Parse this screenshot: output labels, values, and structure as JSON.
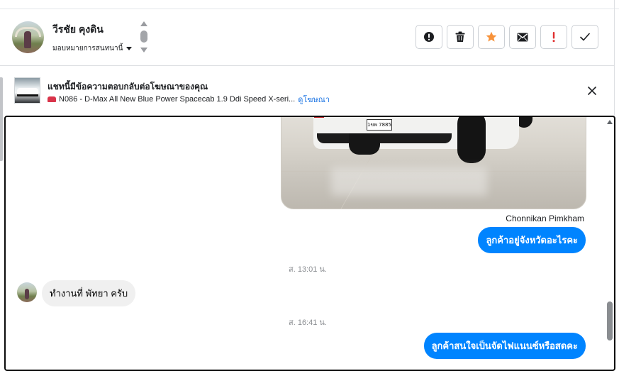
{
  "header": {
    "contact_name": "วีรชัย คุงดิน",
    "assign_label": "มอบหมายการสนทนานี้",
    "actions": [
      {
        "name": "report-button",
        "icon": "exclamation-circle-icon"
      },
      {
        "name": "delete-button",
        "icon": "trash-icon"
      },
      {
        "name": "star-button",
        "icon": "star-icon",
        "color": "#f7923a"
      },
      {
        "name": "mark-unread-button",
        "icon": "envelope-icon"
      },
      {
        "name": "important-button",
        "icon": "exclamation-icon",
        "color": "#e02e2e"
      },
      {
        "name": "mark-done-button",
        "icon": "check-icon"
      }
    ]
  },
  "ad_banner": {
    "title": "แชทนี้มีข้อความตอบกลับต่อโฆษณาของคุณ",
    "ad_text": "N086 - D-Max All New Blue Power Spacecab 1.9 Ddi Speed X-seri...",
    "view_ad_link": "ดูโฆษณา",
    "close_icon": "close-icon"
  },
  "chat": {
    "photo_plate": "1ขพ 7885",
    "sender_name": "Chonnikan Pimkham",
    "messages": [
      {
        "direction": "out",
        "text": "ลูกค้าอยู่จังหวัดอะไรคะ"
      },
      {
        "type": "timestamp",
        "text": "ส. 13:01 น."
      },
      {
        "direction": "in",
        "text": "ทำงานที่ พัทยา ครับ"
      },
      {
        "type": "timestamp",
        "text": "ส. 16:41 น."
      },
      {
        "direction": "out",
        "text": "ลูกค้าสนใจเป็นจัดไฟแนนซ์หรือสดคะ"
      }
    ]
  },
  "colors": {
    "outgoing_bubble": "#0084ff",
    "incoming_bubble": "#f0f0f0",
    "link": "#1b74e4"
  }
}
